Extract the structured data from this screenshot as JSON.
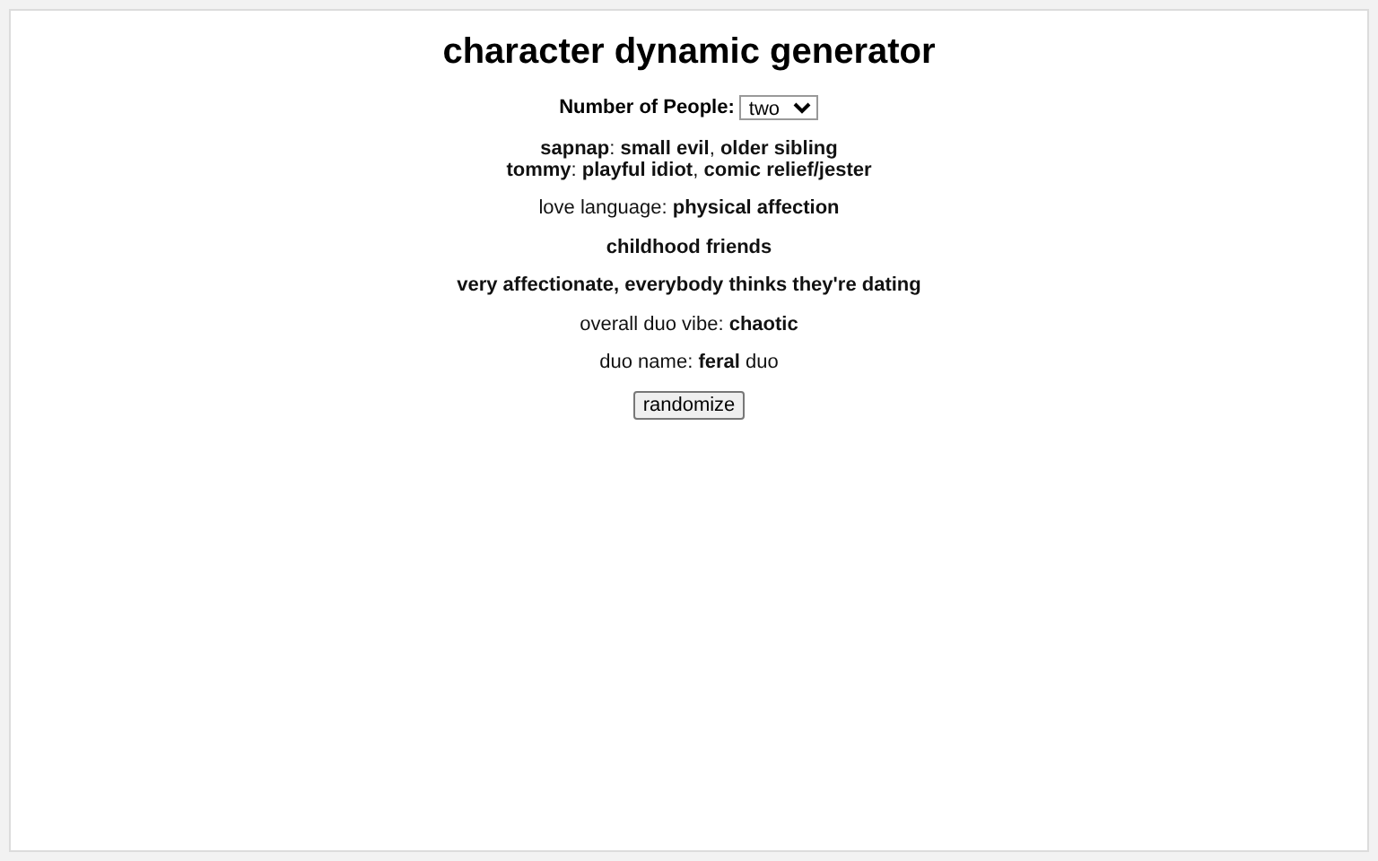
{
  "title": "character dynamic generator",
  "people_count": {
    "label": "Number of People:",
    "value": "two"
  },
  "characters": [
    "**sapnap**: **small evil**, **older sibling**",
    "**tommy**: **playful idiot**, **comic relief/jester**"
  ],
  "lines": [
    "love language: **physical affection**",
    "**childhood friends**",
    "**very affectionate, everybody thinks they're dating**",
    "overall duo vibe: **chaotic**",
    "duo name: **feral** duo"
  ],
  "button": "randomize"
}
